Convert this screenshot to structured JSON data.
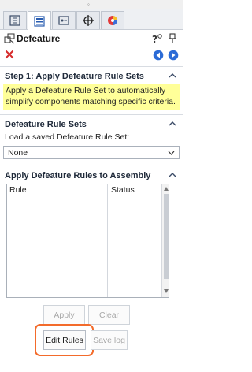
{
  "tabs": [
    {
      "name": "feature-manager",
      "active": false
    },
    {
      "name": "property-manager",
      "active": true
    },
    {
      "name": "configuration-manager",
      "active": false
    },
    {
      "name": "dimxpert-manager",
      "active": false
    },
    {
      "name": "display-manager",
      "active": false
    }
  ],
  "header": {
    "title": "Defeature",
    "icons": [
      "defeature-icon",
      "help-icon",
      "pushpin-icon"
    ]
  },
  "actions": {
    "close_icon": "close-icon",
    "back_icon": "back-arrow-icon",
    "next_icon": "next-arrow-icon"
  },
  "step1": {
    "title": "Step 1: Apply Defeature Rule Sets",
    "note": "Apply a Defeature Rule Set to automatically simplify components matching specific criteria."
  },
  "rule_sets": {
    "title": "Defeature Rule Sets",
    "load_label": "Load a saved Defeature Rule Set:",
    "selected": "None"
  },
  "apply_rules": {
    "title": "Apply Defeature Rules to Assembly",
    "columns": [
      "Rule",
      "Status"
    ]
  },
  "buttons": {
    "apply": "Apply",
    "clear": "Clear",
    "edit_rules": "Edit Rules",
    "save_log": "Save log"
  },
  "colors": {
    "note_bg": "#ffff99",
    "highlight": "#f36b2b",
    "close_red": "#d62b2b",
    "nav_blue": "#2b6bd6"
  }
}
